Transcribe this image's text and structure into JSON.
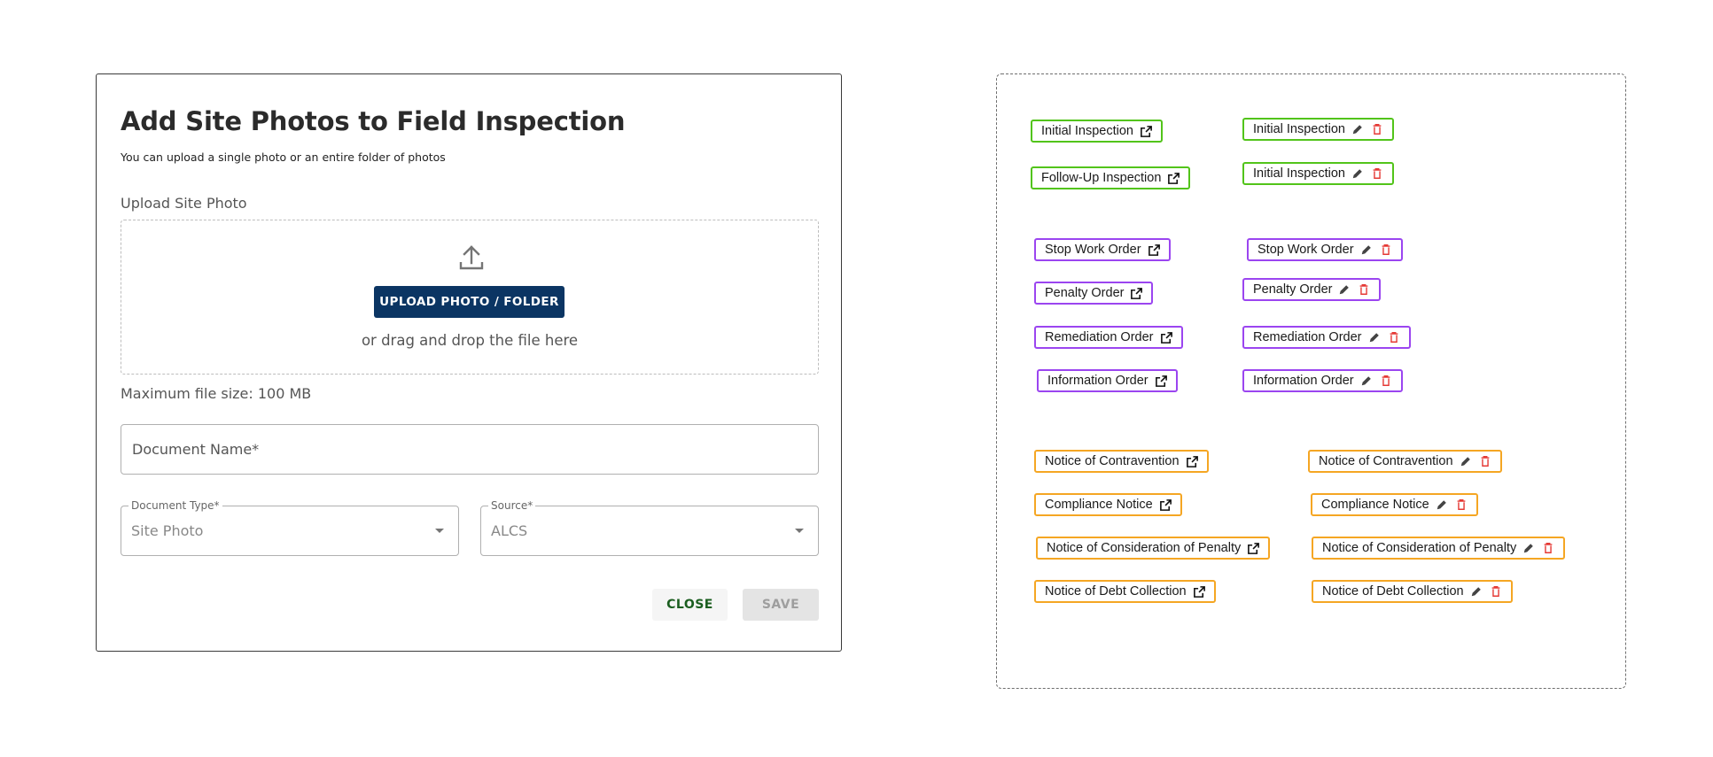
{
  "dialog": {
    "title": "Add Site Photos to Field Inspection",
    "subtitle": "You can upload a single photo or an entire folder of photos",
    "upload_label": "Upload Site Photo",
    "upload_button": "UPLOAD PHOTO / FOLDER",
    "drag_text": "or drag and drop the file here",
    "max_size": "Maximum file size: 100 MB",
    "document_name_placeholder": "Document Name*",
    "document_type": {
      "label": "Document Type*",
      "value": "Site Photo"
    },
    "source": {
      "label": "Source*",
      "value": "ALCS"
    },
    "close_button": "CLOSE",
    "save_button": "SAVE",
    "primary_color": "#0b3563"
  },
  "chips": {
    "colors": {
      "inspection": "#52c41a",
      "order": "#9b45f0",
      "notice": "#f5a623",
      "delete_icon": "#e53935"
    },
    "icons": {
      "view": "open-in-new-icon",
      "edit": "pencil-icon",
      "delete": "trash-icon"
    },
    "inspections_view": [
      "Initial Inspection",
      "Follow-Up Inspection"
    ],
    "inspections_edit": [
      "Initial Inspection",
      "Initial Inspection"
    ],
    "orders_view": [
      "Stop Work Order",
      "Penalty Order",
      "Remediation Order",
      "Information Order"
    ],
    "orders_edit": [
      "Stop Work Order",
      "Penalty Order",
      "Remediation Order",
      "Information Order"
    ],
    "notices_view": [
      "Notice of Contravention",
      "Compliance Notice",
      "Notice of Consideration of Penalty",
      "Notice of Debt Collection"
    ],
    "notices_edit": [
      "Notice of Contravention",
      "Compliance Notice",
      "Notice of Consideration of Penalty",
      "Notice of Debt Collection"
    ]
  }
}
